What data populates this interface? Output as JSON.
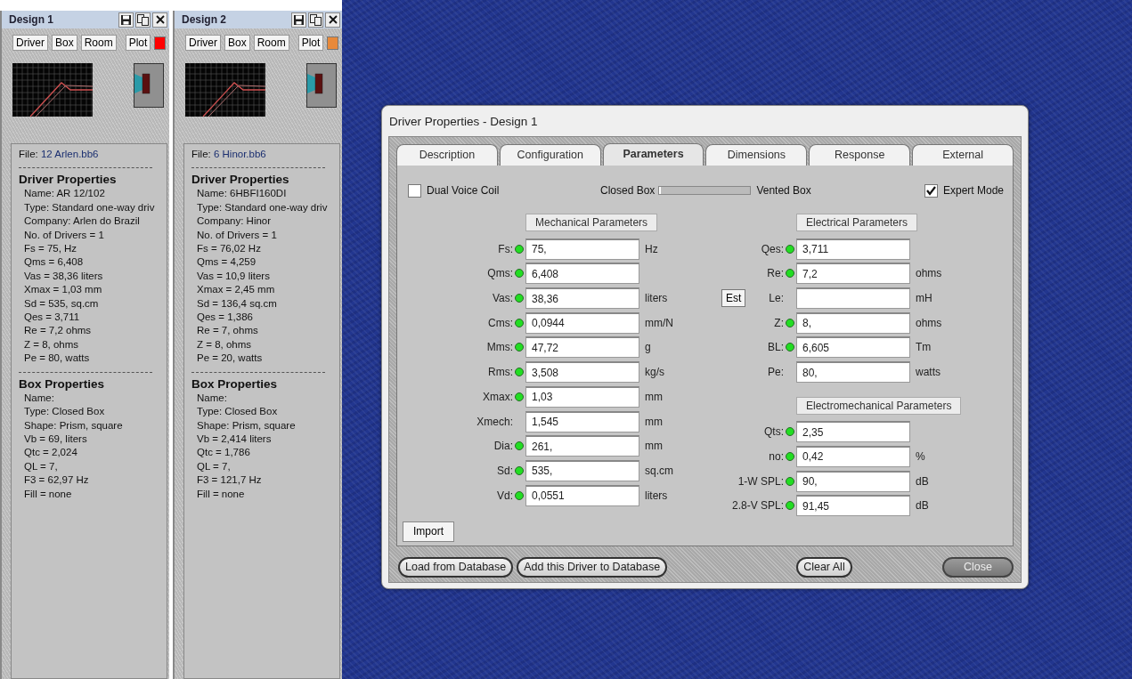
{
  "designs": [
    {
      "title": "Design 1",
      "buttons": [
        "Driver",
        "Box",
        "Room",
        "Plot"
      ],
      "color": "#ff0000",
      "file_label": "File:",
      "file_name": "12 Arlen.bb6",
      "sections": [
        {
          "heading": "Driver Properties",
          "lines": [
            "Name: AR 12/102",
            "Type: Standard one-way driv",
            "Company: Arlen do Brazil",
            "No. of Drivers = 1",
            "Fs =  75, Hz",
            "Qms =  6,408",
            "Vas =  38,36 liters",
            "Xmax =  1,03 mm",
            "Sd =  535, sq.cm",
            "Qes =  3,711",
            "Re =  7,2 ohms",
            "Z =  8, ohms",
            "Pe =  80, watts"
          ]
        },
        {
          "heading": "Box Properties",
          "lines": [
            "Name:",
            "Type: Closed Box",
            "Shape: Prism, square",
            "Vb =  69, liters",
            "Qtc =  2,024",
            "QL =  7,",
            "F3 =  62,97 Hz",
            "Fill = none"
          ]
        }
      ]
    },
    {
      "title": "Design 2",
      "buttons": [
        "Driver",
        "Box",
        "Room",
        "Plot"
      ],
      "color": "#e8893a",
      "file_label": "File:",
      "file_name": "6 Hinor.bb6",
      "sections": [
        {
          "heading": "Driver Properties",
          "lines": [
            "Name: 6HBFI160DI",
            "Type: Standard one-way driv",
            "Company: Hinor",
            "No. of Drivers = 1",
            "Fs =  76,02 Hz",
            "Qms =  4,259",
            "Vas =  10,9 liters",
            "Xmax =  2,45 mm",
            "Sd =  136,4 sq.cm",
            "Qes =  1,386",
            "Re =  7, ohms",
            "Z =  8, ohms",
            "Pe =  20, watts"
          ]
        },
        {
          "heading": "Box Properties",
          "lines": [
            "Name:",
            "Type: Closed Box",
            "Shape: Prism, square",
            "Vb =  2,414 liters",
            "Qtc =  1,786",
            "QL =  7,",
            "F3 =  121,7 Hz",
            "Fill = none"
          ]
        }
      ]
    }
  ],
  "dialog": {
    "title": "Driver Properties - Design 1",
    "tabs": [
      {
        "label": "Description",
        "selected": false
      },
      {
        "label": "Configuration",
        "selected": false
      },
      {
        "label": "Parameters",
        "selected": true
      },
      {
        "label": "Dimensions",
        "selected": false
      },
      {
        "label": "Response",
        "selected": false
      },
      {
        "label": "External",
        "selected": false
      }
    ],
    "dual_voice_coil": {
      "label": "Dual Voice Coil",
      "checked": false
    },
    "box_type": {
      "left_label": "Closed Box",
      "right_label": "Vented Box",
      "level": 0.02
    },
    "expert_mode": {
      "label": "Expert Mode",
      "checked": true
    },
    "mechanical": {
      "heading": "Mechanical Parameters",
      "rows": [
        {
          "label": "Fs:",
          "led": true,
          "value": "75,",
          "unit": "Hz"
        },
        {
          "label": "Qms:",
          "led": true,
          "value": "6,408"
        },
        {
          "label": "Vas:",
          "led": true,
          "value": "38,36",
          "unit": "liters"
        },
        {
          "label": "Cms:",
          "led": true,
          "value": "0,0944",
          "unit": "mm/N"
        },
        {
          "label": "Mms:",
          "led": true,
          "value": "47,72",
          "unit": "g"
        },
        {
          "label": "Rms:",
          "led": true,
          "value": "3,508",
          "unit": "kg/s"
        },
        {
          "label": "Xmax:",
          "led": true,
          "value": "1,03",
          "unit": "mm"
        },
        {
          "label": "Xmech:",
          "led": false,
          "value": "1,545",
          "unit": "mm"
        },
        {
          "label": "Dia:",
          "led": true,
          "value": "261,",
          "unit": "mm"
        },
        {
          "label": "Sd:",
          "led": true,
          "value": "535,",
          "unit": "sq.cm"
        },
        {
          "label": "Vd:",
          "led": true,
          "value": "0,0551",
          "unit": "liters"
        }
      ]
    },
    "electrical": {
      "heading": "Electrical Parameters",
      "rows": [
        {
          "label": "Qes:",
          "led": true,
          "value": "3,711"
        },
        {
          "label": "Re:",
          "led": true,
          "value": "7,2",
          "unit": "ohms"
        },
        {
          "label": "Le:",
          "led": false,
          "unit": "mH",
          "button": "Est"
        },
        {
          "label": "Z:",
          "led": true,
          "value": "8,",
          "unit": "ohms"
        },
        {
          "label": "BL:",
          "led": true,
          "value": "6,605",
          "unit": "Tm"
        },
        {
          "label": "Pe:",
          "led": false,
          "value": "80,",
          "unit": "watts"
        }
      ]
    },
    "electromechanical": {
      "heading": "Electromechanical Parameters",
      "rows": [
        {
          "label": "Qts:",
          "led": true,
          "value": "2,35"
        },
        {
          "label": "no:",
          "led": true,
          "value": "0,42",
          "unit": "%"
        },
        {
          "label": "1-W SPL:",
          "led": true,
          "value": "90,",
          "unit": "dB"
        },
        {
          "label": "2.8-V SPL:",
          "led": true,
          "value": "91,45",
          "unit": "dB"
        }
      ]
    },
    "import_button": "Import",
    "footer_buttons": [
      {
        "label": "Load from Database",
        "default": false
      },
      {
        "label": "Add this Driver to Database",
        "default": false
      },
      {
        "label": "Clear All",
        "default": false
      },
      {
        "label": "Close",
        "default": true
      }
    ]
  }
}
